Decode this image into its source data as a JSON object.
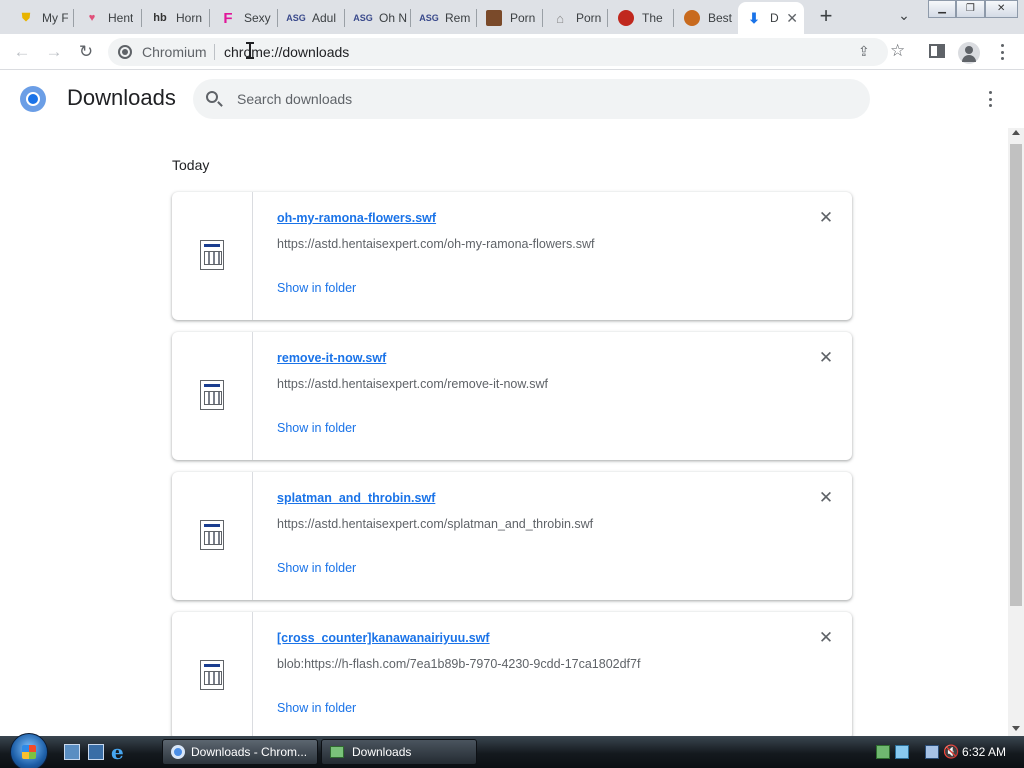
{
  "browser": {
    "tabs": [
      {
        "title": "My F",
        "favicon": "shield-icon",
        "favicon_color": "#e8b400"
      },
      {
        "title": "Hent",
        "favicon": "heart-icon",
        "favicon_color": "#e0507a"
      },
      {
        "title": "Horn",
        "favicon": "hb-logo-icon",
        "favicon_color": "#333333"
      },
      {
        "title": "Sexy",
        "favicon": "f-logo-icon",
        "favicon_color": "#e0169a"
      },
      {
        "title": "Adul",
        "favicon": "asg-logo-icon",
        "favicon_color": "#3a4a8c"
      },
      {
        "title": "Oh N",
        "favicon": "asg-logo-icon",
        "favicon_color": "#3a4a8c"
      },
      {
        "title": "Rem",
        "favicon": "asg-logo-icon",
        "favicon_color": "#3a4a8c"
      },
      {
        "title": "Porn",
        "favicon": "image-icon",
        "favicon_color": "#7a4a2a"
      },
      {
        "title": "Porn",
        "favicon": "gamepad-icon",
        "favicon_color": "#888888"
      },
      {
        "title": "The",
        "favicon": "circle-logo-icon",
        "favicon_color": "#c0281e"
      },
      {
        "title": "Best",
        "favicon": "face-logo-icon",
        "favicon_color": "#c86a1e"
      },
      {
        "title": "D",
        "favicon": "download-icon",
        "favicon_color": "#1a73e8",
        "active": true
      }
    ],
    "omnibox": {
      "chip": "Chromium",
      "url": "chrome://downloads"
    }
  },
  "downloads": {
    "title": "Downloads",
    "search_placeholder": "Search downloads",
    "section_label": "Today",
    "items": [
      {
        "name": "oh-my-ramona-flowers.swf",
        "url": "https://astd.hentaisexpert.com/oh-my-ramona-flowers.swf",
        "action": "Show in folder"
      },
      {
        "name": "remove-it-now.swf",
        "url": "https://astd.hentaisexpert.com/remove-it-now.swf",
        "action": "Show in folder"
      },
      {
        "name": "splatman_and_throbin.swf",
        "url": "https://astd.hentaisexpert.com/splatman_and_throbin.swf",
        "action": "Show in folder"
      },
      {
        "name": "[cross_counter]kanawanairiyuu.swf",
        "url": "blob:https://h-flash.com/7ea1b89b-7970-4230-9cdd-17ca1802df7f",
        "action": "Show in folder"
      }
    ]
  },
  "taskbar": {
    "buttons": [
      {
        "label": "Downloads - Chrom...",
        "icon": "chromium-icon",
        "active": true
      },
      {
        "label": "Downloads",
        "icon": "folder-icon",
        "active": false
      }
    ],
    "clock": "6:32 AM"
  },
  "colors": {
    "accent": "#1a73e8",
    "tabstrip": "#dee1e6",
    "taskbar": "#1b2228"
  }
}
